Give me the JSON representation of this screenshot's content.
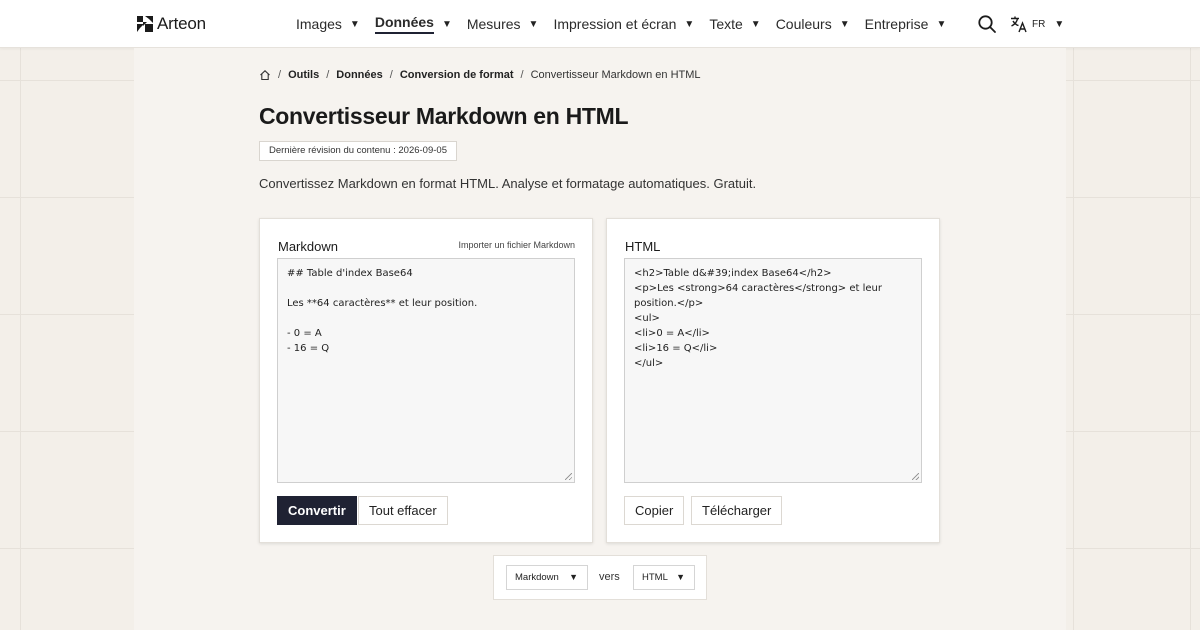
{
  "brand": {
    "name": "Arteon"
  },
  "nav": {
    "items": [
      {
        "label": "Images"
      },
      {
        "label": "Données"
      },
      {
        "label": "Mesures"
      },
      {
        "label": "Impression et écran"
      },
      {
        "label": "Texte"
      },
      {
        "label": "Couleurs"
      },
      {
        "label": "Entreprise"
      }
    ],
    "active": "Données",
    "caret": "▼"
  },
  "language": {
    "code": "FR"
  },
  "breadcrumb": {
    "sep": "/",
    "items": [
      "Outils",
      "Données",
      "Conversion de format"
    ],
    "current": "Convertisseur Markdown en HTML"
  },
  "page": {
    "title": "Convertisseur Markdown en HTML",
    "revision": "Dernière révision du contenu : 2026-09-05",
    "description": "Convertissez Markdown en format HTML. Analyse et formatage automatiques. Gratuit."
  },
  "input_panel": {
    "title": "Markdown",
    "import_label": "Importer un fichier Markdown",
    "content": "## Table d'index Base64\n\nLes **64 caractères** et leur position.\n\n- 0 = A\n- 16 = Q",
    "convert_label": "Convertir",
    "clear_label": "Tout effacer"
  },
  "output_panel": {
    "title": "HTML",
    "content": "<h2>Table d&#39;index Base64</h2>\n<p>Les <strong>64 caractères</strong> et leur position.</p>\n<ul>\n<li>0 = A</li>\n<li>16 = Q</li>\n</ul>",
    "copy_label": "Copier",
    "download_label": "Télécharger"
  },
  "format_selector": {
    "from": "Markdown",
    "to_word": "vers",
    "target": "HTML"
  },
  "colors": {
    "primary_button": "#1f2233",
    "page_background": "#f3efe9",
    "panel_background": "#f6f3ef"
  }
}
